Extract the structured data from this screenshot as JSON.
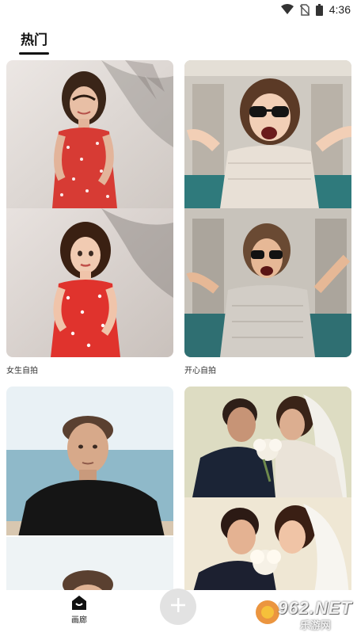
{
  "status_bar": {
    "time": "4:36",
    "icons": [
      "wifi-icon",
      "no-sim-icon",
      "battery-icon"
    ]
  },
  "tabs": [
    {
      "label": "热门",
      "active": true
    }
  ],
  "cards": [
    {
      "label": "女生自拍"
    },
    {
      "label": "开心自拍"
    },
    {
      "label": ""
    },
    {
      "label": ""
    }
  ],
  "bottom_nav": {
    "home_label": "画廊",
    "add_icon": "plus-icon"
  },
  "watermark": {
    "text": "962.NET",
    "subtext": "乐游网"
  }
}
